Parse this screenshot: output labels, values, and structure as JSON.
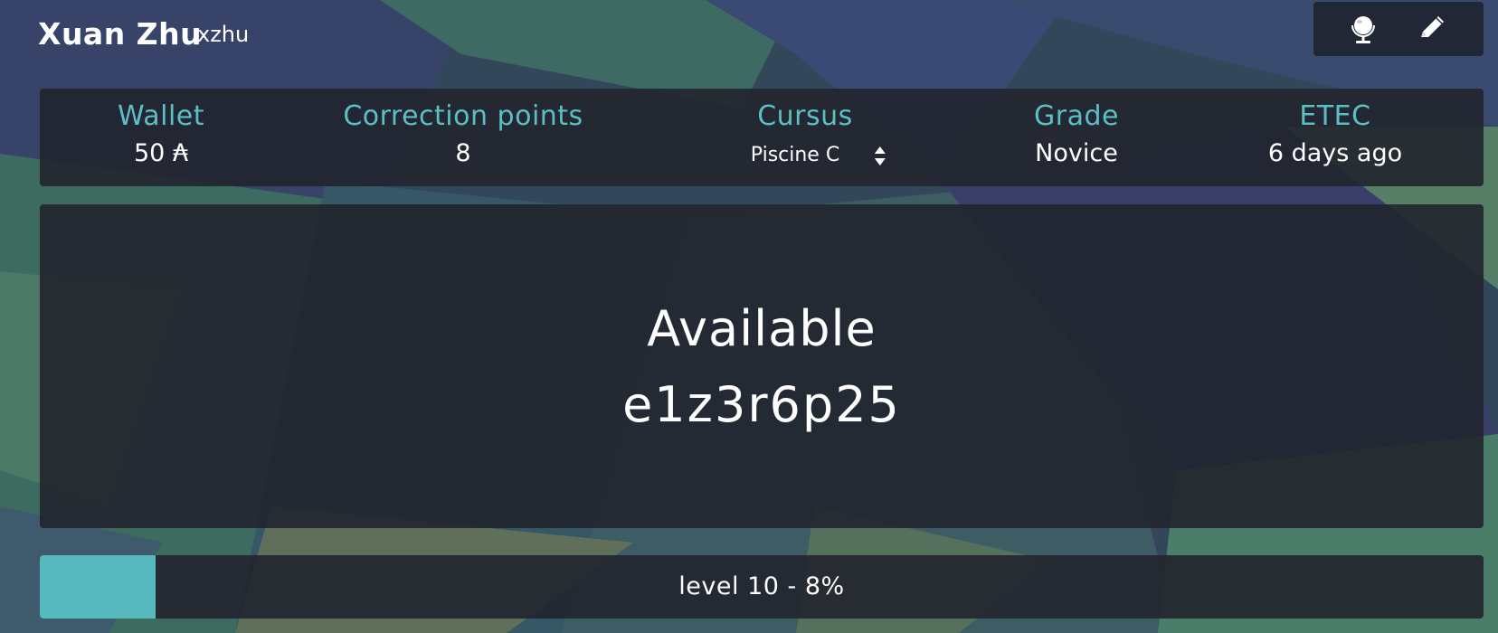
{
  "user": {
    "display_name": "Xuan Zhu",
    "login": "xzhu"
  },
  "toolbar": {
    "globe_icon": "globe-icon",
    "edit_icon": "pencil-icon"
  },
  "stats": {
    "wallet": {
      "label": "Wallet",
      "value": "50 ₳"
    },
    "correction_points": {
      "label": "Correction points",
      "value": "8"
    },
    "cursus": {
      "label": "Cursus",
      "selected": "Piscine C"
    },
    "grade": {
      "label": "Grade",
      "value": "Novice"
    },
    "etec": {
      "label": "ETEC",
      "value": "6 days ago"
    }
  },
  "location": {
    "status": "Available",
    "host": "e1z3r6p25"
  },
  "level": {
    "text": "level 10 - 8%",
    "progress_percent": 8
  },
  "colors": {
    "accent": "#5bbfc3",
    "level_fill": "#55b9bd",
    "panel": "#21252e"
  }
}
